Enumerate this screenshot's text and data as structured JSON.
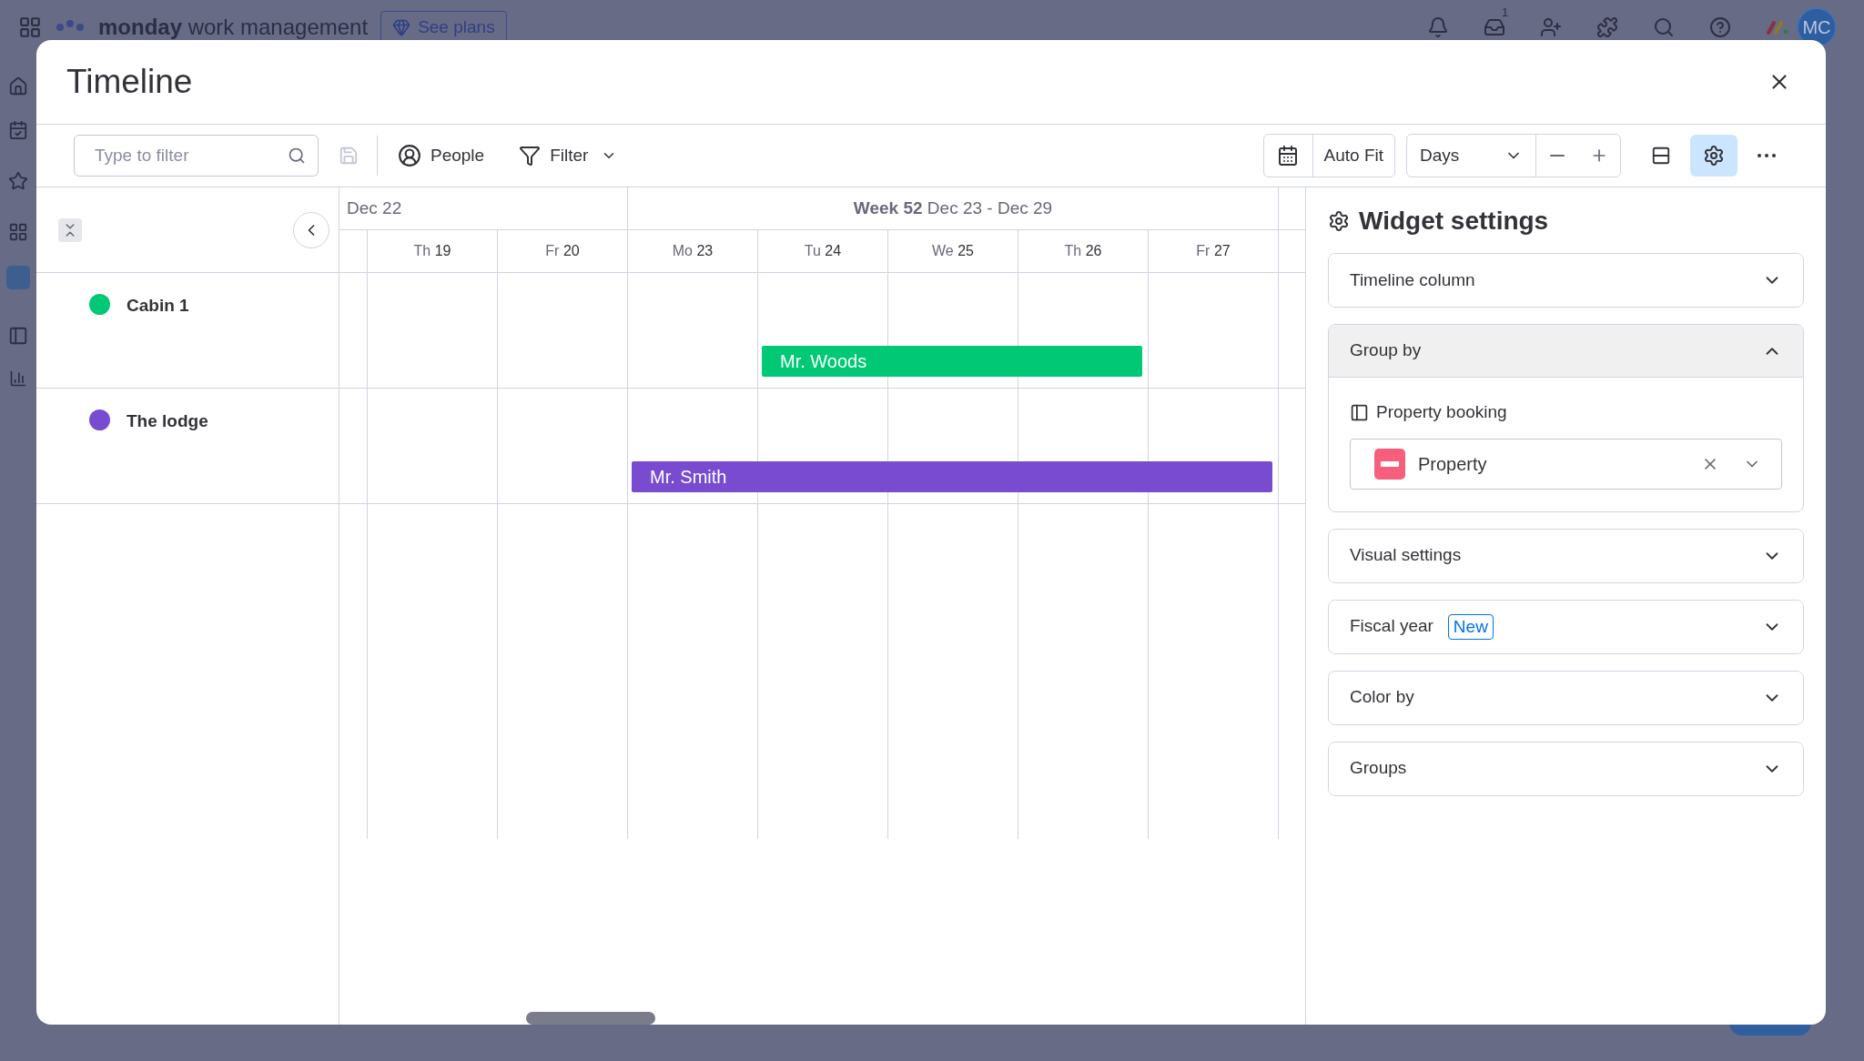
{
  "app_bar": {
    "brand_bold": "monday",
    "brand_rest": "work management",
    "plans_button": "See plans",
    "inbox_badge": "1",
    "avatar": "MC"
  },
  "dialog": {
    "title": "Timeline"
  },
  "toolbar": {
    "search": {
      "placeholder": "Type to filter"
    },
    "people": "People",
    "filter": "Filter",
    "auto_fit": "Auto Fit",
    "zoom": {
      "value": "Days"
    },
    "settings_selected": true
  },
  "timeline": {
    "weeks": [
      "Dec 22",
      "**Week 52** Dec 23 - Dec 29"
    ],
    "days": [
      {
        "abbr": "Th",
        "num": "19"
      },
      {
        "abbr": "Fr",
        "num": "20"
      },
      {
        "abbr": "Mo",
        "num": "23"
      },
      {
        "abbr": "Tu",
        "num": "24"
      },
      {
        "abbr": "We",
        "num": "25"
      },
      {
        "abbr": "Th",
        "num": "26"
      },
      {
        "abbr": "Fr",
        "num": "27"
      }
    ],
    "groups": [
      {
        "name": "Cabin 1",
        "color": "#00c875",
        "items": [
          {
            "name": "Mr. Woods"
          }
        ]
      },
      {
        "name": "The lodge",
        "color": "#784bd1",
        "items": [
          {
            "name": "Mr. Smith"
          }
        ]
      }
    ]
  },
  "settings": {
    "title": "Widget settings",
    "sections": [
      {
        "label": "Timeline column",
        "expanded": false
      },
      {
        "label": "Group by",
        "expanded": true,
        "board": "Property booking",
        "column": "Property"
      },
      {
        "label": "Visual settings",
        "expanded": false
      },
      {
        "label": "Fiscal year",
        "expanded": false,
        "badge": "New"
      },
      {
        "label": "Color by",
        "expanded": false
      },
      {
        "label": "Groups",
        "expanded": false
      }
    ]
  }
}
